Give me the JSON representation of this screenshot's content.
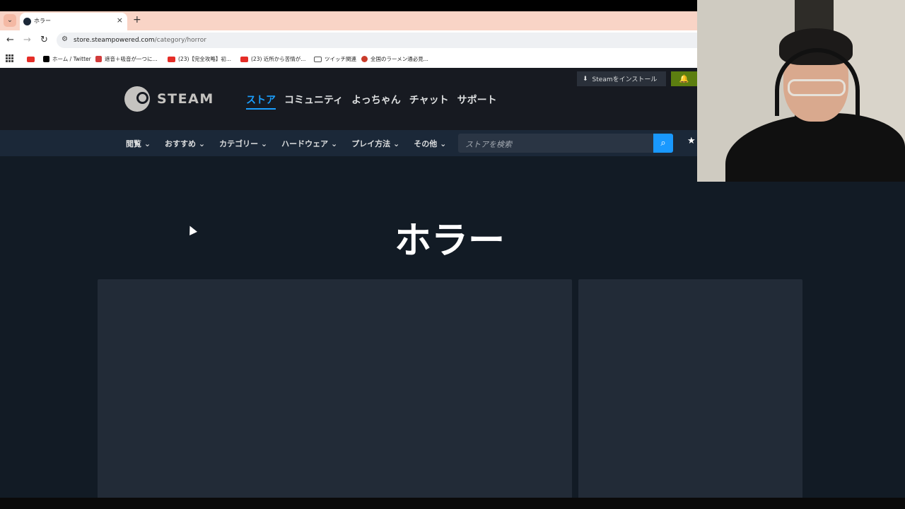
{
  "browser": {
    "tab": {
      "title": "ホラー",
      "close": "×"
    },
    "new_tab": "+",
    "tab_list": "⌄",
    "nav": {
      "back": "←",
      "forward": "→",
      "reload": "↻"
    },
    "url": {
      "host": "store.steampowered.com",
      "path": "/category/horror"
    },
    "bookmarks": [
      {
        "label": "",
        "icon": "youtube"
      },
      {
        "label": "ホーム / Twitter",
        "icon": "x"
      },
      {
        "label": "遮音＋吸音が一つに...",
        "icon": "red-square"
      },
      {
        "label": "(23)【完全攻略】初...",
        "icon": "youtube"
      },
      {
        "label": "(23) 近所から苦情が...",
        "icon": "youtube"
      },
      {
        "label": "ツイッチ関連",
        "icon": "folder"
      },
      {
        "label": "全国のラーメン通必見...",
        "icon": "ramen"
      }
    ]
  },
  "steam": {
    "logo_text": "STEAM",
    "main_nav": [
      "ストア",
      "コミュニティ",
      "よっちゃん",
      "チャット",
      "サポート"
    ],
    "install_button": "Steamをインストール",
    "sub_nav": [
      "閲覧 ⌄",
      "おすすめ ⌄",
      "カテゴリー ⌄",
      "ハードウェア ⌄",
      "プレイ方法 ⌄",
      "その他 ⌄"
    ],
    "search_placeholder": "ストアを検索",
    "page_title": "ホラー"
  },
  "colors": {
    "steam_header": "#171a21",
    "steam_bg": "#121b25",
    "accent_blue": "#1a9fff",
    "install_green": "#5c7e10"
  }
}
